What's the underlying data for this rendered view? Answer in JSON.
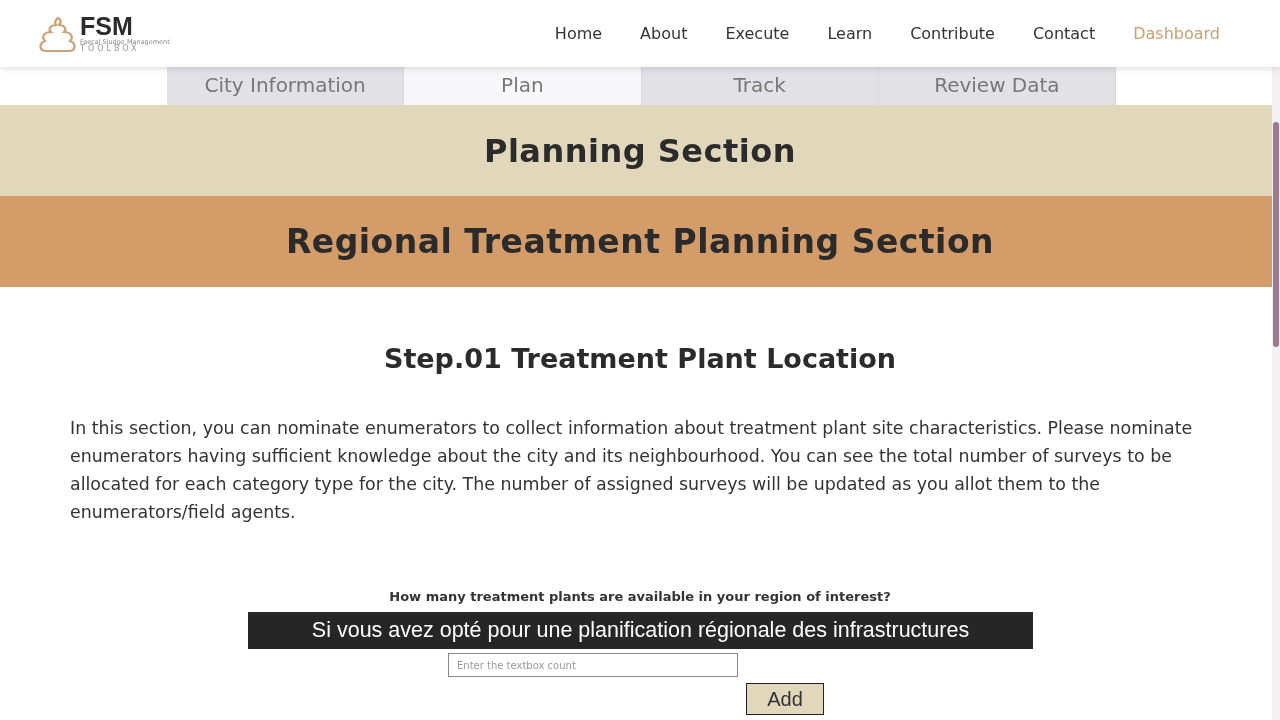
{
  "logo": {
    "title": "FSM",
    "tagline": "Faecal Sludge Management",
    "subtitle": "TOOLBOX"
  },
  "nav": [
    {
      "label": "Home",
      "selected": false
    },
    {
      "label": "About",
      "selected": false
    },
    {
      "label": "Execute",
      "selected": false
    },
    {
      "label": "Learn",
      "selected": false
    },
    {
      "label": "Contribute",
      "selected": false
    },
    {
      "label": "Contact",
      "selected": false
    },
    {
      "label": "Dashboard",
      "selected": true
    }
  ],
  "tabs": [
    {
      "label": "City Information",
      "selected": false
    },
    {
      "label": "Plan",
      "selected": true
    },
    {
      "label": "Track",
      "selected": false
    },
    {
      "label": "Review Data",
      "selected": false
    }
  ],
  "section_title": "Planning Section",
  "subsection_title": "Regional Treatment Planning Section",
  "step_title": "Step.01 Treatment Plant Location",
  "description": "In this section, you can nominate enumerators to collect information about treatment plant site characteristics. Please nominate enumerators having sufficient knowledge about the city and its neighbourhood. You can see the total number of surveys to be allocated for each category type for the city. The number of assigned surveys will be updated as you allot them to the enumerators/field agents.",
  "question": "How many treatment plants are available in your region of interest?",
  "count_field": {
    "placeholder": "Enter the textbox count"
  },
  "add_button": "Add",
  "caption": "Si vous avez opté pour une planification régionale des infrastructures"
}
